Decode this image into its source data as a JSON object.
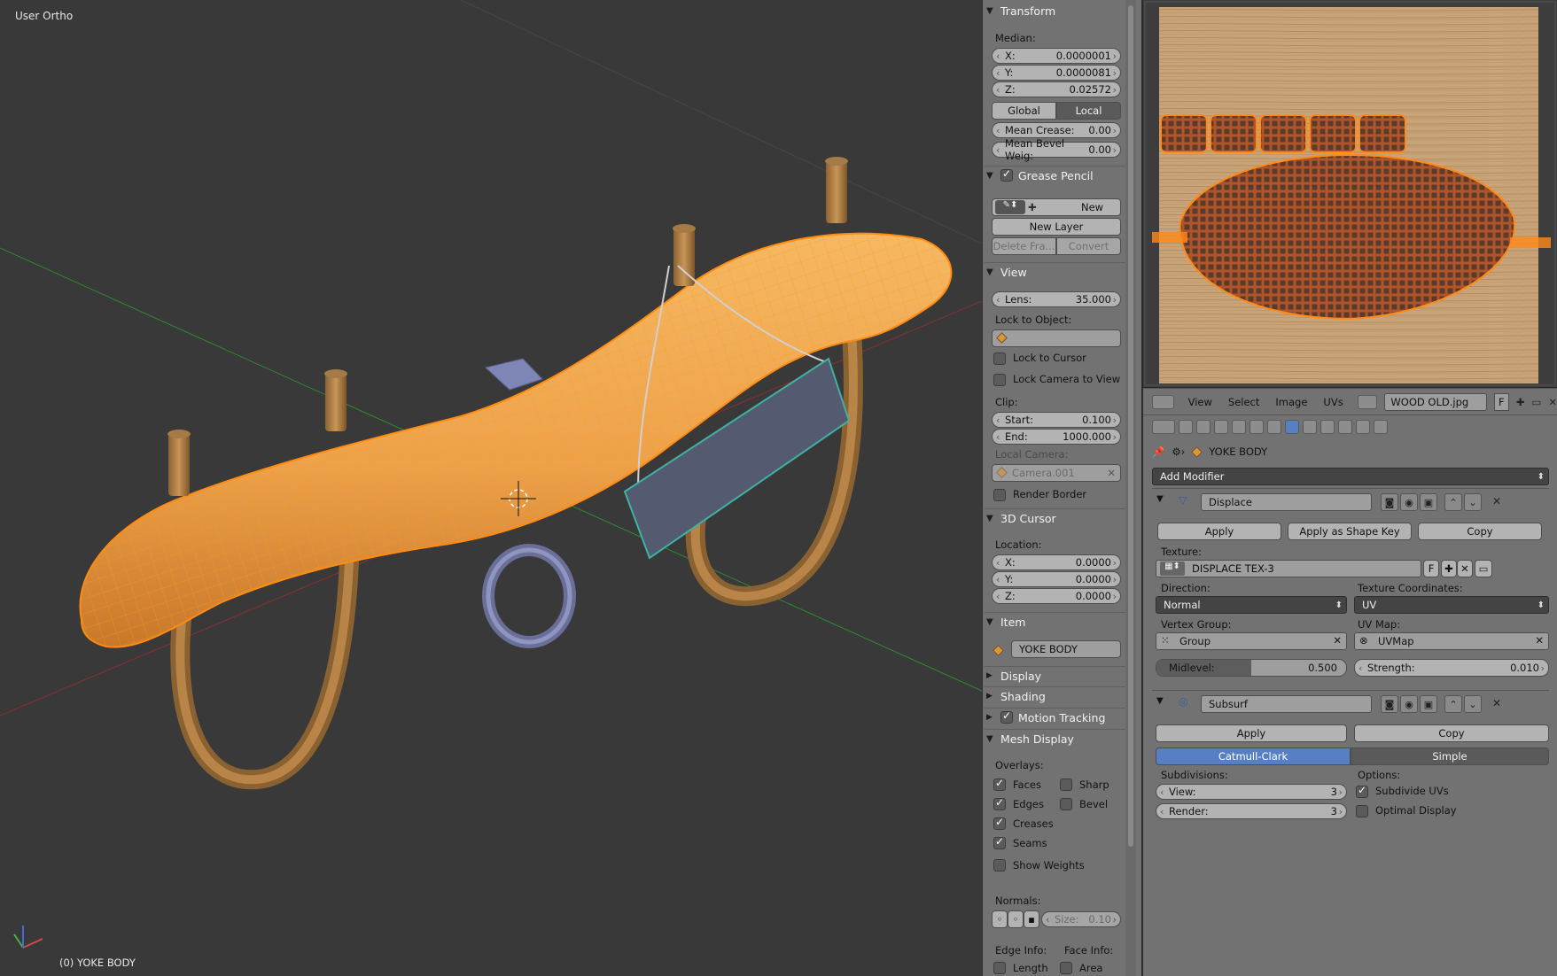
{
  "viewport": {
    "view_label": "User Ortho",
    "object_label": "(0) YOKE BODY"
  },
  "npanel": {
    "transform": {
      "title": "Transform",
      "median_label": "Median:",
      "x": {
        "label": "X:",
        "value": "0.0000001"
      },
      "y": {
        "label": "Y:",
        "value": "0.0000081"
      },
      "z": {
        "label": "Z:",
        "value": "0.02572"
      },
      "global_label": "Global",
      "local_label": "Local",
      "mean_crease": {
        "label": "Mean Crease:",
        "value": "0.00"
      },
      "mean_bevel": {
        "label": "Mean Bevel Weig:",
        "value": "0.00"
      }
    },
    "grease_pencil": {
      "title": "Grease Pencil",
      "new_label": "New",
      "new_layer_label": "New Layer",
      "delete_frame_label": "Delete Fra...",
      "convert_label": "Convert"
    },
    "view": {
      "title": "View",
      "lens": {
        "label": "Lens:",
        "value": "35.000"
      },
      "lock_to_object_label": "Lock to Object:",
      "lock_to_cursor_label": "Lock to Cursor",
      "lock_camera_label": "Lock Camera to View",
      "clip_label": "Clip:",
      "clip_start": {
        "label": "Start:",
        "value": "0.100"
      },
      "clip_end": {
        "label": "End:",
        "value": "1000.000"
      },
      "local_camera_label": "Local Camera:",
      "local_camera_value": "Camera.001",
      "render_border_label": "Render Border"
    },
    "cursor": {
      "title": "3D Cursor",
      "location_label": "Location:",
      "x": {
        "label": "X:",
        "value": "0.0000"
      },
      "y": {
        "label": "Y:",
        "value": "0.0000"
      },
      "z": {
        "label": "Z:",
        "value": "0.0000"
      }
    },
    "item": {
      "title": "Item",
      "name": "YOKE BODY"
    },
    "display_title": "Display",
    "shading_title": "Shading",
    "motion_tracking_title": "Motion Tracking",
    "mesh_display": {
      "title": "Mesh Display",
      "overlays_label": "Overlays:",
      "faces": "Faces",
      "sharp": "Sharp",
      "edges": "Edges",
      "bevel": "Bevel",
      "creases": "Creases",
      "seams": "Seams",
      "show_weights": "Show Weights",
      "normals_label": "Normals:",
      "size": {
        "label": "Size:",
        "value": "0.10"
      },
      "edge_info_label": "Edge Info:",
      "face_info_label": "Face Info:",
      "length": "Length",
      "area": "Area"
    }
  },
  "uv_header": {
    "menus": [
      "View",
      "Select",
      "Image",
      "UVs"
    ],
    "image_name": "WOOD OLD.jpg",
    "fake_user": "F"
  },
  "properties": {
    "object_name": "YOKE BODY",
    "add_modifier_label": "Add Modifier",
    "displace": {
      "name": "Displace",
      "apply_label": "Apply",
      "apply_shape_label": "Apply as Shape Key",
      "copy_label": "Copy",
      "texture_label": "Texture:",
      "texture_value": "DISPLACE TEX-3",
      "texture_fake_user": "F",
      "direction_label": "Direction:",
      "direction_value": "Normal",
      "tex_coords_label": "Texture Coordinates:",
      "tex_coords_value": "UV",
      "vertex_group_label": "Vertex Group:",
      "vertex_group_value": "Group",
      "uv_map_label": "UV Map:",
      "uv_map_value": "UVMap",
      "midlevel": {
        "label": "Midlevel:",
        "value": "0.500",
        "fraction": 0.5
      },
      "strength": {
        "label": "Strength:",
        "value": "0.010"
      }
    },
    "subsurf": {
      "name": "Subsurf",
      "apply_label": "Apply",
      "copy_label": "Copy",
      "catmull_label": "Catmull-Clark",
      "simple_label": "Simple",
      "subdivisions_label": "Subdivisions:",
      "options_label": "Options:",
      "view": {
        "label": "View:",
        "value": "3"
      },
      "render": {
        "label": "Render:",
        "value": "3"
      },
      "subdivide_uvs_label": "Subdivide UVs",
      "optimal_display_label": "Optimal Display"
    }
  },
  "colors": {
    "viewport_bg": "#393939",
    "selection_orange": "#f0a64a",
    "wire_orange": "#ff9a1a",
    "active_blue": "#5680c2"
  }
}
